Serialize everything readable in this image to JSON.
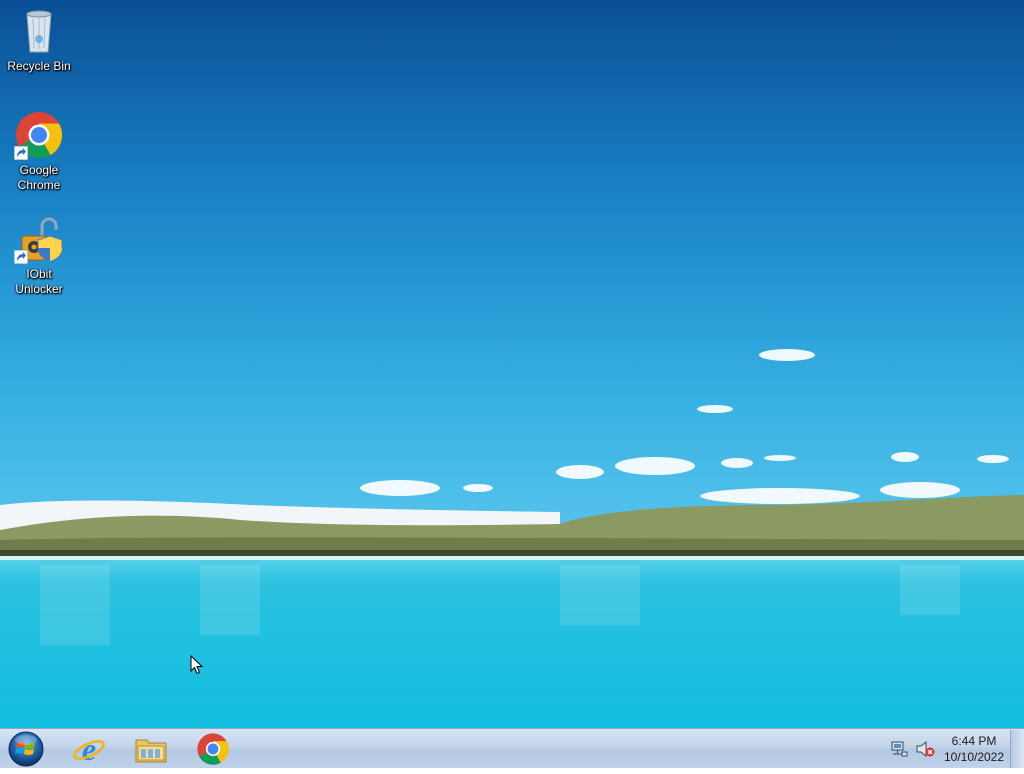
{
  "desktop": {
    "icons": [
      {
        "label": "Recycle Bin",
        "icon": "recycle-bin-icon"
      },
      {
        "label": "Google Chrome",
        "icon": "chrome-icon"
      },
      {
        "label": "IObit Unlocker",
        "icon": "iobit-unlocker-icon"
      }
    ]
  },
  "taskbar": {
    "start": {
      "icon": "windows-start-icon"
    },
    "pinned": [
      {
        "name": "Internet Explorer",
        "icon": "internet-explorer-icon"
      },
      {
        "name": "Windows Explorer",
        "icon": "file-explorer-icon"
      },
      {
        "name": "Google Chrome",
        "icon": "chrome-icon"
      }
    ],
    "tray": {
      "network_icon": "network-icon",
      "volume_icon": "volume-muted-icon",
      "time": "6:44 PM",
      "date": "10/10/2022"
    }
  },
  "colors": {
    "sky_top": "#0b5fa8",
    "sky_bottom": "#3bb6e6",
    "lake": "#22c3e0",
    "taskbar": "#c3d4ea"
  }
}
